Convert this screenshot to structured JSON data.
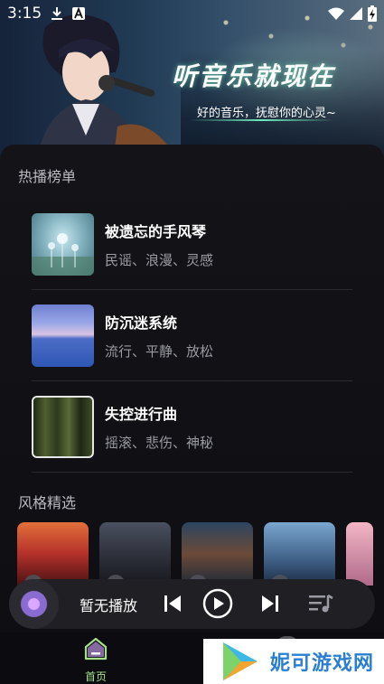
{
  "status_bar": {
    "time": "3:15",
    "icons": [
      "download-icon",
      "a-badge-icon",
      "wifi-icon",
      "signal-icon",
      "battery-charging-icon"
    ]
  },
  "banner": {
    "title": "听音乐就现在",
    "subtitle": "好的音乐，抚慰你的心灵~"
  },
  "hot_section": {
    "title": "热播榜单",
    "items": [
      {
        "name": "被遗忘的手风琴",
        "tags": "民谣、浪漫、灵感",
        "cover": "dandelion-field"
      },
      {
        "name": "防沉迷系统",
        "tags": "流行、平静、放松",
        "cover": "sunset-sea"
      },
      {
        "name": "失控进行曲",
        "tags": "摇滚、悲伤、神秘",
        "cover": "forest"
      }
    ]
  },
  "style_section": {
    "title": "风格精选",
    "cards": [
      "singer-red",
      "singer-dark",
      "singer-blue",
      "couple-night",
      "pink-partial"
    ]
  },
  "player": {
    "status": "暂无播放",
    "icons": [
      "prev-icon",
      "play-icon",
      "next-icon",
      "playlist-icon"
    ]
  },
  "bottom_nav": {
    "home_label": "首页",
    "active_color": "#a6e08a"
  },
  "watermark": {
    "text": "妮可游戏网"
  }
}
